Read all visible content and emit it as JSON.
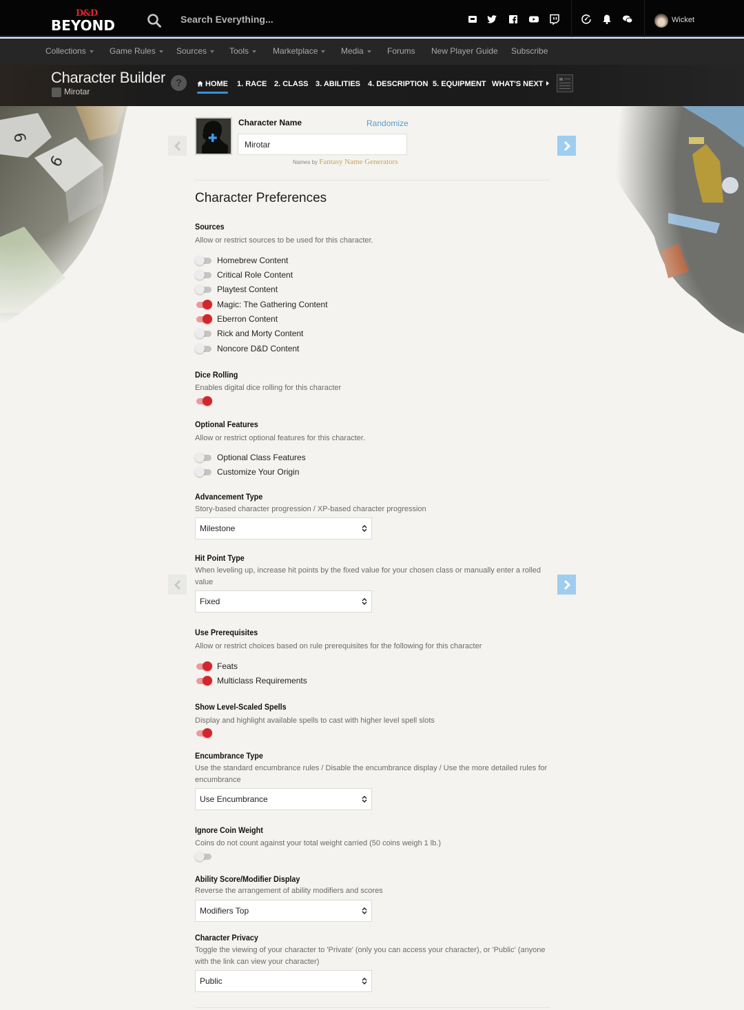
{
  "header": {
    "logo_top": "D&D",
    "logo_bottom": "BEYOND",
    "search_placeholder": "Search Everything...",
    "social_icons": [
      "discord-icon",
      "twitter-icon",
      "facebook-icon",
      "youtube-icon",
      "twitch-icon"
    ],
    "action_icons": [
      "compass-icon",
      "bell-icon",
      "chat-icon"
    ],
    "user_name": "Wicket"
  },
  "subnav": {
    "items": [
      {
        "label": "Collections",
        "dropdown": true
      },
      {
        "label": "Game Rules",
        "dropdown": true
      },
      {
        "label": "Sources",
        "dropdown": true
      },
      {
        "label": "Tools",
        "dropdown": true
      },
      {
        "label": "Marketplace",
        "dropdown": true
      },
      {
        "label": "Media",
        "dropdown": true
      },
      {
        "label": "Forums",
        "dropdown": false
      },
      {
        "label": "New Player Guide",
        "dropdown": false
      },
      {
        "label": "Subscribe",
        "dropdown": false
      }
    ]
  },
  "builder": {
    "title": "Character Builder",
    "character_name": "Mirotar",
    "help_label": "?",
    "steps": [
      {
        "label": "HOME",
        "active": true
      },
      {
        "label": "1. RACE",
        "active": false
      },
      {
        "label": "2. CLASS",
        "active": false
      },
      {
        "label": "3. ABILITIES",
        "active": false
      },
      {
        "label": "4. DESCRIPTION",
        "active": false
      },
      {
        "label": "5. EQUIPMENT",
        "active": false
      },
      {
        "label": "WHAT'S NEXT",
        "active": false
      }
    ]
  },
  "name_section": {
    "label": "Character Name",
    "randomize": "Randomize",
    "value": "Mirotar",
    "names_by": "Names by",
    "names_by_link": "Fantasy Name Generators"
  },
  "prefs": {
    "title": "Character Preferences",
    "sources": {
      "heading": "Sources",
      "description": "Allow or restrict sources to be used for this character.",
      "toggles": [
        {
          "label": "Homebrew Content",
          "on": false
        },
        {
          "label": "Critical Role Content",
          "on": false
        },
        {
          "label": "Playtest Content",
          "on": false
        },
        {
          "label": "Magic: The Gathering Content",
          "on": true
        },
        {
          "label": "Eberron Content",
          "on": true
        },
        {
          "label": "Rick and Morty Content",
          "on": false
        },
        {
          "label": "Noncore D&D Content",
          "on": false
        }
      ]
    },
    "dice_rolling": {
      "heading": "Dice Rolling",
      "description": "Enables digital dice rolling for this character",
      "on": true
    },
    "optional_features": {
      "heading": "Optional Features",
      "description": "Allow or restrict optional features for this character.",
      "toggles": [
        {
          "label": "Optional Class Features",
          "on": false
        },
        {
          "label": "Customize Your Origin",
          "on": false
        }
      ]
    },
    "advancement": {
      "heading": "Advancement Type",
      "description": "Story-based character progression / XP-based character progression",
      "value": "Milestone"
    },
    "hit_points": {
      "heading": "Hit Point Type",
      "description": "When leveling up, increase hit points by the fixed value for your chosen class or manually enter a rolled value",
      "value": "Fixed"
    },
    "prerequisites": {
      "heading": "Use Prerequisites",
      "description": "Allow or restrict choices based on rule prerequisites for the following for this character",
      "toggles": [
        {
          "label": "Feats",
          "on": true
        },
        {
          "label": "Multiclass Requirements",
          "on": true
        }
      ]
    },
    "level_scaled": {
      "heading": "Show Level-Scaled Spells",
      "description": "Display and highlight available spells to cast with higher level spell slots",
      "on": true
    },
    "encumbrance": {
      "heading": "Encumbrance Type",
      "description": "Use the standard encumbrance rules / Disable the encumbrance display / Use the more detailed rules for encumbrance",
      "value": "Use Encumbrance"
    },
    "coin_weight": {
      "heading": "Ignore Coin Weight",
      "description": "Coins do not count against your total weight carried (50 coins weigh 1 lb.)",
      "on": false
    },
    "ability_display": {
      "heading": "Ability Score/Modifier Display",
      "description": "Reverse the arrangement of ability modifiers and scores",
      "value": "Modifiers Top"
    },
    "privacy": {
      "heading": "Character Privacy",
      "description": "Toggle the viewing of your character to 'Private' (only you can access your character), or 'Public' (anyone with the link can view your character)",
      "value": "Public"
    }
  },
  "colors": {
    "accent_blue": "#3d8ed6",
    "toggle_on": "#d3262c",
    "randomize_link": "#5c9bc9",
    "next_arrow": "#9fcdf0"
  }
}
